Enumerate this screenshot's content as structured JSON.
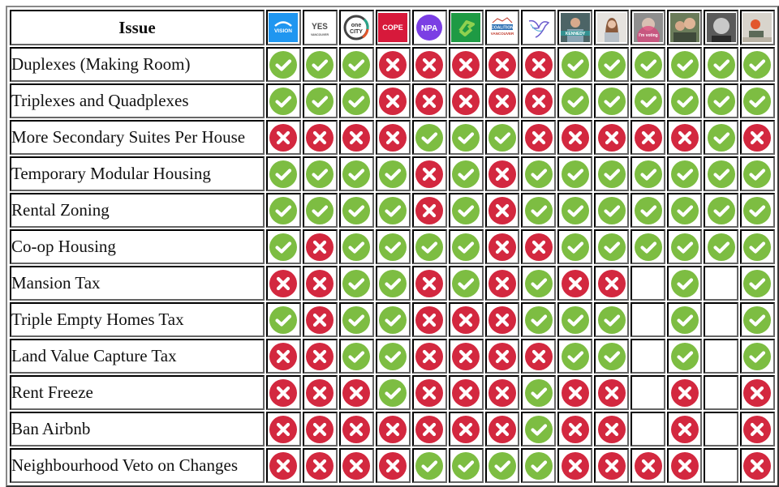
{
  "table": {
    "issue_header": "Issue",
    "colors": {
      "yes": "#7dbd42",
      "no": "#d3283f"
    },
    "columns": [
      {
        "id": "vision",
        "icon": "vision-vancouver-logo",
        "text": "VISION",
        "bg": "#1f96f0",
        "fg": "#ffffff"
      },
      {
        "id": "yes",
        "icon": "yes-vancouver-logo",
        "text": "YES",
        "sub": "VANCOUVER",
        "bg": "#ffffff",
        "fg": "#555555"
      },
      {
        "id": "onecity",
        "icon": "onecity-logo",
        "text": "one",
        "sub": "CITY",
        "bg": "#ffffff",
        "fg": "#333333"
      },
      {
        "id": "cope",
        "icon": "cope-logo",
        "text": "COPE",
        "bg": "#d7193b",
        "fg": "#ffffff"
      },
      {
        "id": "npa",
        "icon": "npa-logo",
        "text": "NPA",
        "bg": "#ffffff",
        "fg": "#ffffff",
        "accent": "#7b3fe4"
      },
      {
        "id": "green",
        "icon": "green-party-logo",
        "text": "G",
        "bg": "#1e9a44",
        "fg": "#8fd14f"
      },
      {
        "id": "coalition",
        "icon": "coalition-vancouver-logo",
        "text": "COALITION",
        "sub": "VANCOUVER",
        "bg": "#ffffff",
        "fg": "#2b6fb3",
        "accent": "#c0392b"
      },
      {
        "id": "progress",
        "icon": "bird-logo",
        "text": "",
        "bg": "#ffffff",
        "fg": "#6a5acd"
      },
      {
        "id": "kennedy",
        "icon": "kennedy-stewart-photo",
        "text": "KENNEDY",
        "bg": "#5d6b6b",
        "fg": "#ffffff"
      },
      {
        "id": "cand2",
        "icon": "candidate-photo-woman",
        "text": "",
        "bg": "#c9b7a7",
        "fg": "#ffffff"
      },
      {
        "id": "cand3",
        "icon": "candidate-photo-im-voting",
        "text": "I'm voting",
        "bg": "#8e8e8e",
        "fg": "#ffffff",
        "accent": "#e0407a"
      },
      {
        "id": "cand4",
        "icon": "candidate-photo-couple",
        "text": "",
        "bg": "#6b7c5a",
        "fg": "#ffffff"
      },
      {
        "id": "cand5",
        "icon": "candidate-photo-bw",
        "text": "",
        "bg": "#5a5a5a",
        "fg": "#ffffff"
      },
      {
        "id": "cand6",
        "icon": "candidate-photo-desk",
        "text": "",
        "bg": "#d8d4cc",
        "fg": "#ffffff",
        "accent": "#e2572c"
      }
    ],
    "rows": [
      {
        "issue": "Duplexes (Making Room)",
        "marks": [
          "yes",
          "yes",
          "yes",
          "no",
          "no",
          "no",
          "no",
          "no",
          "yes",
          "yes",
          "yes",
          "yes",
          "yes",
          "yes"
        ]
      },
      {
        "issue": "Triplexes and Quadplexes",
        "marks": [
          "yes",
          "yes",
          "yes",
          "no",
          "no",
          "no",
          "no",
          "no",
          "yes",
          "yes",
          "yes",
          "yes",
          "yes",
          "yes"
        ]
      },
      {
        "issue": "More Secondary Suites Per House",
        "marks": [
          "no",
          "no",
          "no",
          "no",
          "yes",
          "yes",
          "yes",
          "no",
          "no",
          "no",
          "no",
          "no",
          "yes",
          "no"
        ]
      },
      {
        "issue": "Temporary Modular Housing",
        "marks": [
          "yes",
          "yes",
          "yes",
          "yes",
          "no",
          "yes",
          "no",
          "yes",
          "yes",
          "yes",
          "yes",
          "yes",
          "yes",
          "yes"
        ]
      },
      {
        "issue": "Rental Zoning",
        "marks": [
          "yes",
          "yes",
          "yes",
          "yes",
          "no",
          "yes",
          "no",
          "yes",
          "yes",
          "yes",
          "yes",
          "yes",
          "yes",
          "yes"
        ]
      },
      {
        "issue": "Co-op Housing",
        "marks": [
          "yes",
          "no",
          "yes",
          "yes",
          "yes",
          "yes",
          "no",
          "no",
          "yes",
          "yes",
          "yes",
          "yes",
          "yes",
          "yes"
        ]
      },
      {
        "issue": "Mansion Tax",
        "marks": [
          "no",
          "no",
          "yes",
          "yes",
          "no",
          "yes",
          "no",
          "yes",
          "no",
          "no",
          "",
          "yes",
          "",
          "yes"
        ]
      },
      {
        "issue": "Triple Empty Homes Tax",
        "marks": [
          "yes",
          "no",
          "yes",
          "yes",
          "no",
          "no",
          "no",
          "yes",
          "yes",
          "yes",
          "",
          "yes",
          "",
          "yes"
        ]
      },
      {
        "issue": "Land Value Capture Tax",
        "marks": [
          "no",
          "no",
          "yes",
          "yes",
          "no",
          "no",
          "no",
          "no",
          "yes",
          "yes",
          "",
          "yes",
          "",
          "yes"
        ]
      },
      {
        "issue": "Rent Freeze",
        "marks": [
          "no",
          "no",
          "no",
          "yes",
          "no",
          "no",
          "no",
          "yes",
          "no",
          "no",
          "",
          "no",
          "",
          "no"
        ]
      },
      {
        "issue": "Ban Airbnb",
        "marks": [
          "no",
          "no",
          "no",
          "no",
          "no",
          "no",
          "no",
          "yes",
          "no",
          "no",
          "",
          "no",
          "",
          "no"
        ]
      },
      {
        "issue": "Neighbourhood Veto on Changes",
        "marks": [
          "no",
          "no",
          "no",
          "no",
          "yes",
          "yes",
          "yes",
          "yes",
          "no",
          "no",
          "no",
          "no",
          "",
          "no"
        ]
      }
    ]
  }
}
